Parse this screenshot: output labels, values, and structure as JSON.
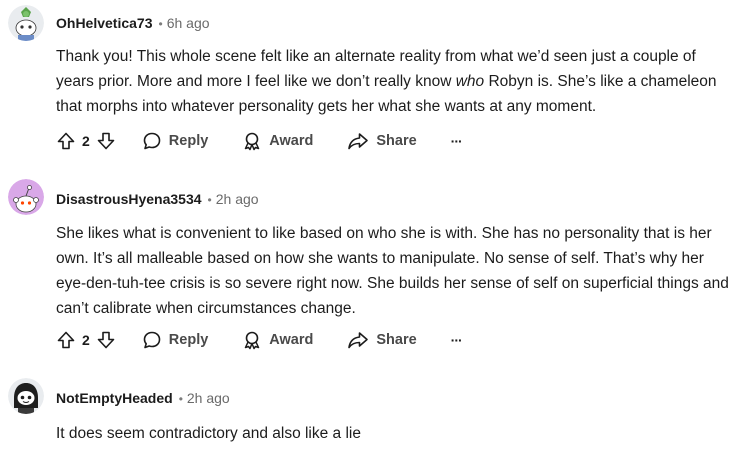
{
  "comments": [
    {
      "username": "OhHelvetica73",
      "separator": "•",
      "time": "6h ago",
      "body_pre": "Thank you! This whole scene felt like an alternate reality from what we’d seen just a couple of years prior. More and more I feel like we don’t really know ",
      "body_em": "who",
      "body_post": " Robyn is. She’s like a chameleon that morphs into whatever personality gets her what she wants at any moment.",
      "votes": "2",
      "reply_label": "Reply",
      "award_label": "Award",
      "share_label": "Share",
      "more_label": "···"
    },
    {
      "username": "DisastrousHyena3534",
      "separator": "•",
      "time": "2h ago",
      "body": "She likes what is convenient to like based on who she is with. She has no personality that is her own. It’s all malleable based on how she wants to manipulate. No sense of self. That’s why her eye-den-tuh-tee crisis is so severe right now. She builds her sense of self on superficial things and can’t calibrate when circumstances change.",
      "votes": "2",
      "reply_label": "Reply",
      "award_label": "Award",
      "share_label": "Share",
      "more_label": "···"
    },
    {
      "username": "NotEmptyHeaded",
      "separator": "•",
      "time": "2h ago",
      "body": "It does seem contradictory and also like a lie"
    }
  ],
  "colors": {
    "avatar1_bg": "#e9ecef",
    "avatar2_bg": "#d9a8e8",
    "avatar3_bg": "#e9ecef",
    "action_text": "#4a4a4a"
  },
  "icons": {
    "upvote": "upvote-arrow-icon",
    "downvote": "downvote-arrow-icon",
    "reply": "speech-bubble-icon",
    "award": "award-ribbon-icon",
    "share": "share-arrow-icon",
    "more": "ellipsis-icon"
  }
}
